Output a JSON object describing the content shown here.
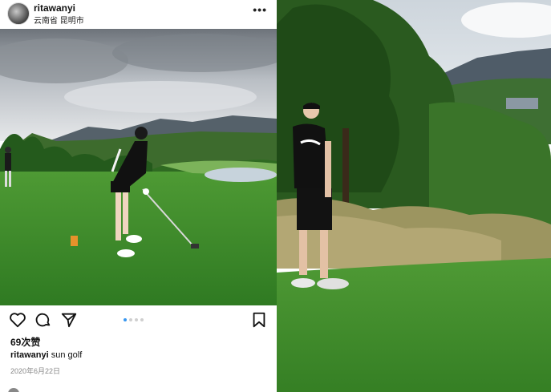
{
  "post": {
    "username": "ritawanyi",
    "location": "云南省 昆明市",
    "more_label": "•••",
    "likes": "69次赞",
    "caption_user": "ritawanyi",
    "caption_text": " sun golf",
    "date": "2020年6月22日",
    "carousel": {
      "count": 4,
      "active": 1
    },
    "icons": [
      "heart-icon",
      "comment-icon",
      "share-icon",
      "bookmark-icon"
    ]
  },
  "colors": {
    "grass": "#3f8a2c",
    "sky": "#c8ccd0",
    "accent_dot": "#3897f0"
  }
}
